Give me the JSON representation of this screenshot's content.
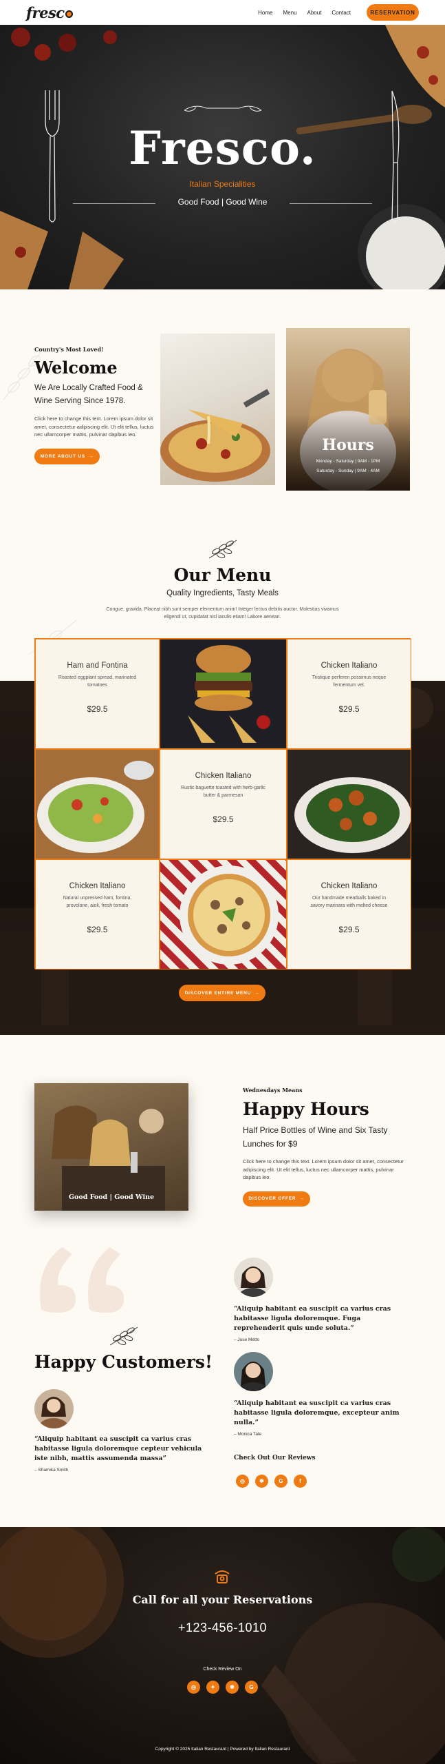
{
  "nav": {
    "logo": "fresc",
    "links": [
      "Home",
      "Menu",
      "About",
      "Contact"
    ],
    "cta": "RESERVATION"
  },
  "hero": {
    "title": "Fresco.",
    "subtitle": "Italian Specialities",
    "tagline": "Good Food | Good Wine"
  },
  "welcome": {
    "eyebrow": "Country's Most Loved!",
    "title": "Welcome",
    "subtitle": "We Are Locally Crafted Food & Wine Serving Since 1978.",
    "body": "Click here to change this text. Lorem ipsum dolor sit amet, consectetur adipiscing elit. Ut elit tellus, luctus nec ullamcorper mattis, pulvinar dapibus leo.",
    "button": "MORE ABOUT US",
    "hours": {
      "title": "Hours",
      "line1": "Monday - Saturday | 9AM - 1PM",
      "line2": "Saturday - Sunday | 9AM - 4AM"
    }
  },
  "menu": {
    "title": "Our Menu",
    "subtitle": "Quality Ingredients, Tasty Meals",
    "intro": "Congue, gravida. Placeat nibh sunt semper elementum anim! Integer lectus debitis auctor. Molestias vivamus eligendi ut, cupidatat nisl iaculis etiam! Labore aenean.",
    "items": [
      {
        "name": "Ham and Fontina",
        "desc": "Roasted eggplant spread, marinated tomatoes",
        "price": "$29.5"
      },
      {
        "name": "Chicken Italiano",
        "desc": "Tristique perferen possimus neque fermentum vel.",
        "price": "$29.5"
      },
      {
        "name": "Chicken Italiano",
        "desc": "Rustic baguette toasted with herb-garlic butter & parmesan",
        "price": "$29.5"
      },
      {
        "name": "Chicken Italiano",
        "desc": "Natural unpressed ham, fontina, provolone, aioli, fresh tomato",
        "price": "$29.5"
      },
      {
        "name": "Chicken Italiano",
        "desc": "Our handmade meatballs baked in savory marinara with melted cheese",
        "price": "$29.5"
      }
    ],
    "button": "DISCOVER ENTIRE MENU"
  },
  "happy_hours": {
    "eyebrow": "Wednesdays Means",
    "title": "Happy Hours",
    "subtitle": "Half Price Bottles of Wine and Six Tasty Lunches for $9",
    "body": "Click here to change this text. Lorem ipsum dolor sit amet, consectetur adipiscing elit. Ut elit tellus, luctus nec ullamcorper mattis, pulvinar dapibus leo.",
    "image_caption": "Good Food | Good Wine",
    "button": "DISCOVER OFFER"
  },
  "testimonials": {
    "title": "Happy Customers!",
    "left": {
      "quote": "“Aliquip habitant ea suscipit ca varius cras habitasse ligula doloremque cepteur vehicula iste nibh, mattis assumenda massa”",
      "name": "– Shamika Smith"
    },
    "right": [
      {
        "quote": "“Aliquip habitant ea suscipit ca varius cras habitasse ligula doloremque. Fuga reprehenderit quis unde soluta.”",
        "name": "– Jose Metts"
      },
      {
        "quote": "“Aliquip habitant ea suscipit ca varius cras habitasse ligula doloremque, excepteur anim nulla.”",
        "name": "– Monica Tate"
      }
    ],
    "reviews_label": "Check Out Our Reviews"
  },
  "footer": {
    "call": "Call for all your Reservations",
    "phone": "+123-456-1010",
    "review_label": "Check Review On",
    "copyright": "Copyright © 2025 Italian Restaurant | Powered by Italian Restaurant"
  },
  "colors": {
    "accent": "#f07b13",
    "dark": "#1a1a1a",
    "cream": "#fdf9f3"
  }
}
